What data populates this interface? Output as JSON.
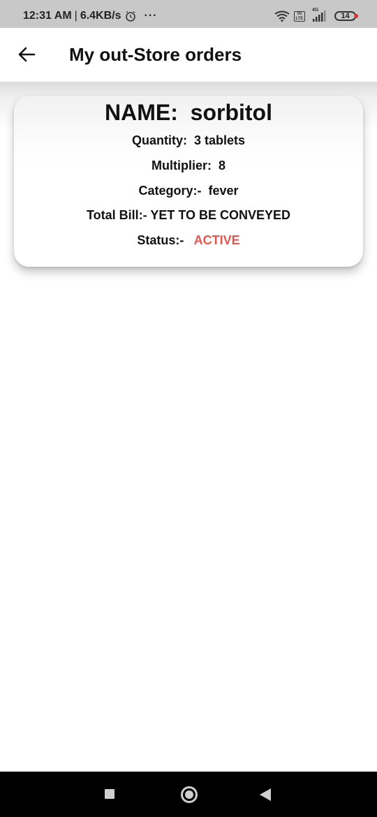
{
  "status_bar": {
    "time": "12:31 AM",
    "separator": "|",
    "network_speed": "6.4KB/s",
    "more": "···",
    "volte_top": "Vo",
    "volte_bottom": "LTE",
    "network_type": "4G",
    "battery_level": "14",
    "icons": [
      "alarm-icon",
      "more-icon",
      "wifi-icon",
      "volte-icon",
      "signal-icon",
      "battery-icon"
    ]
  },
  "app_bar": {
    "title": "My out-Store orders",
    "back_icon": "arrow-left-icon"
  },
  "order": {
    "name_label": "NAME:",
    "name_value": "sorbitol",
    "quantity_label": "Quantity:",
    "quantity_value": "3 tablets",
    "multiplier_label": "Multiplier:",
    "multiplier_value": "8",
    "category_label": "Category:-",
    "category_value": "fever",
    "total_bill_label": "Total Bill:-",
    "total_bill_value": "YET TO BE CONVEYED",
    "status_label": "Status:-",
    "status_value": "ACTIVE"
  },
  "colors": {
    "status_active": "#e25850",
    "status_bar_bg": "#c8c8c8",
    "nav_bar_bg": "#000000"
  },
  "nav_bar": {
    "icons": [
      "recents-square-icon",
      "home-circle-icon",
      "back-triangle-icon"
    ]
  }
}
